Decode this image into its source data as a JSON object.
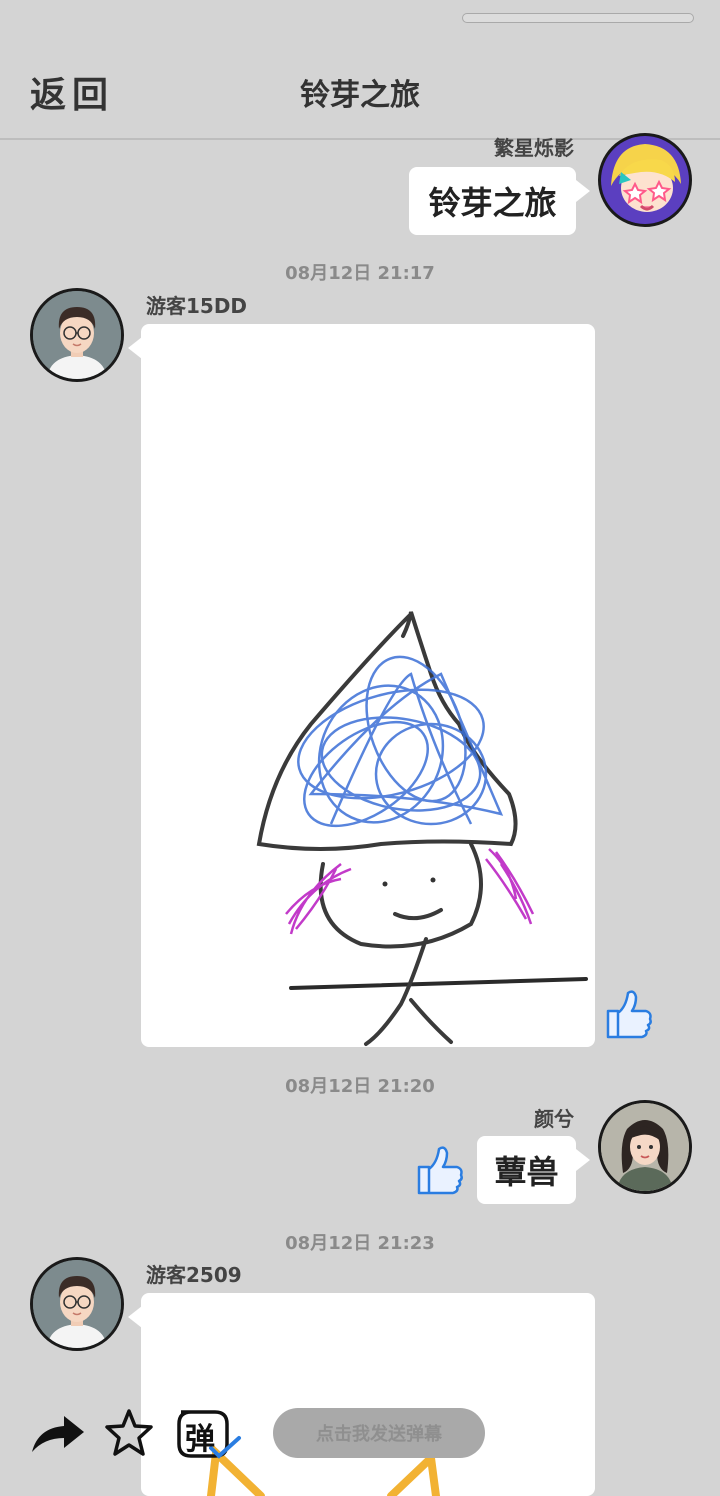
{
  "header": {
    "back_label": "返回",
    "title": "铃芽之旅"
  },
  "messages": [
    {
      "sender": "繁星烁影",
      "side": "right",
      "text": "铃芽之旅"
    },
    {
      "time": "08月12日  21:17",
      "sender": "游客15DD",
      "side": "left",
      "type": "image",
      "image_desc_icon": "drawing-image",
      "liked": true
    },
    {
      "time": "08月12日  21:20",
      "sender": "颜兮",
      "side": "right",
      "text": "蕈兽",
      "liked": true
    },
    {
      "time": "08月12日  21:23",
      "sender": "游客2509",
      "side": "left",
      "type": "image"
    }
  ],
  "toolbar": {
    "share_icon": "share-arrow-icon",
    "favorite_icon": "star-icon",
    "danmu_icon": "danmu-toggle-icon",
    "danmu_glyph": "弹",
    "danmu_placeholder": "点击我发送弹幕"
  },
  "colors": {
    "background": "#d4d4d4",
    "bubble": "#ffffff",
    "like_blue": "#2a7de1",
    "hat_blue": "#3b6fd6",
    "hair_magenta": "#c23ac9"
  }
}
